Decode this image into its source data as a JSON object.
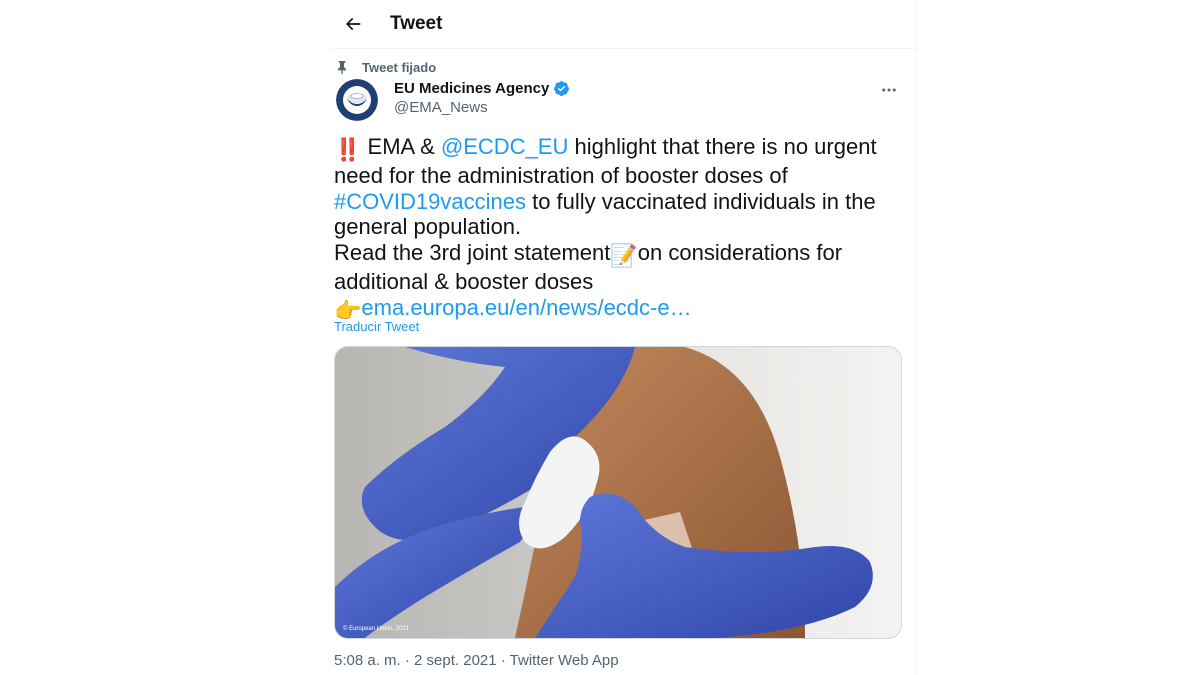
{
  "header": {
    "title": "Tweet"
  },
  "pinned": {
    "label": "Tweet fijado"
  },
  "author": {
    "display_name": "EU Medicines Agency",
    "handle": "@EMA_News",
    "verified": true
  },
  "tweet": {
    "emoji_alert": "‼️",
    "segments": [
      {
        "text": " EMA & ",
        "type": "text"
      },
      {
        "text": "@ECDC_EU",
        "type": "mention"
      },
      {
        "text": " highlight that there is no urgent need for the administration of booster doses of ",
        "type": "text"
      },
      {
        "text": "#COVID19vaccines",
        "type": "hashtag"
      },
      {
        "text": " to fully vaccinated individuals in the general population.",
        "type": "text"
      }
    ],
    "line2_start": "Read the 3rd joint statement",
    "emoji_memo": "📝",
    "line2_end": "on considerations for additional & booster doses",
    "emoji_point": "👉",
    "link": "ema.europa.eu/en/news/ecdc-e…"
  },
  "translate_label": "Traducir Tweet",
  "media": {
    "description": "vaccination photo",
    "credit": "© European Union, 2021"
  },
  "meta": {
    "timestamp": "5:08 a. m. · 2 sept. 2021 · Twitter Web App"
  },
  "colors": {
    "accent": "#1d9bf0",
    "text": "#0f1419",
    "secondary": "#536471",
    "border": "#eff3f4"
  },
  "icons": [
    "back-arrow-icon",
    "pin-icon",
    "verified-badge-icon",
    "more-icon"
  ]
}
